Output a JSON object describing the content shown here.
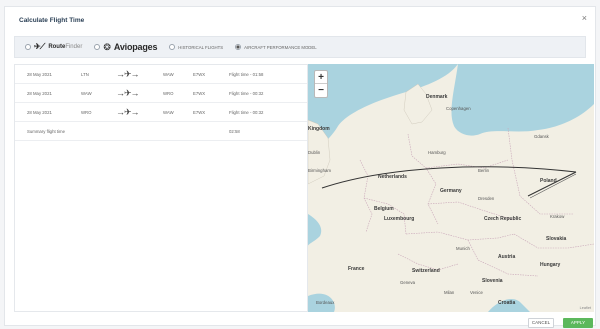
{
  "dialog": {
    "title": "Calculate Flight Time",
    "close_label": "×"
  },
  "toolbar": {
    "routefinder": {
      "logo_a": "Route",
      "logo_b": "Finder"
    },
    "aviopages": {
      "label": "Aviopages"
    },
    "historical": {
      "label": "HISTORICAL FLIGHTS"
    },
    "performance": {
      "label": "AIRCRAFT PERFORMANCE MODEL",
      "selected": true
    }
  },
  "rows": [
    {
      "date": "28 May 2021",
      "from": "LTN",
      "to": "WAW",
      "type": "E7WX",
      "flight_time": "Flight time - 01:58"
    },
    {
      "date": "28 May 2021",
      "from": "WAW",
      "to": "WRO",
      "type": "E7WX",
      "flight_time": "Flight time - 00:32"
    },
    {
      "date": "28 May 2021",
      "from": "WRO",
      "to": "WAW",
      "type": "E7WX",
      "flight_time": "Flight time - 00:32"
    }
  ],
  "summary": {
    "label": "Summary flight time",
    "value": "02:58"
  },
  "map": {
    "zoom_in": "+",
    "zoom_out": "−",
    "labels": {
      "denmark": "Denmark",
      "copenhagen": "Copenhagen",
      "kingdom": "Kingdom",
      "dublin": "Dublin",
      "birmingham": "Birmingham",
      "netherlands": "Netherlands",
      "hamburg": "Hamburg",
      "berlin": "Berlin",
      "germany": "Germany",
      "poland": "Poland",
      "gdansk": "Gdansk",
      "belgium": "Belgium",
      "luxembourg": "Luxembourg",
      "dresden": "Dresden",
      "czech": "Czech Republic",
      "krakow": "Krakow",
      "munich": "Munich",
      "slovakia": "Slovakia",
      "austria": "Austria",
      "france": "France",
      "switzerland": "Switzerland",
      "hungary": "Hungary",
      "slovenia": "Slovenia",
      "croatia": "Croatia",
      "milan": "Milan",
      "venice": "Venice",
      "geneva": "Geneva",
      "bordeaux": "Bordeaux"
    },
    "attribution": "Leaflet"
  },
  "buttons": {
    "cancel": "CANCEL",
    "apply": "APPLY"
  }
}
